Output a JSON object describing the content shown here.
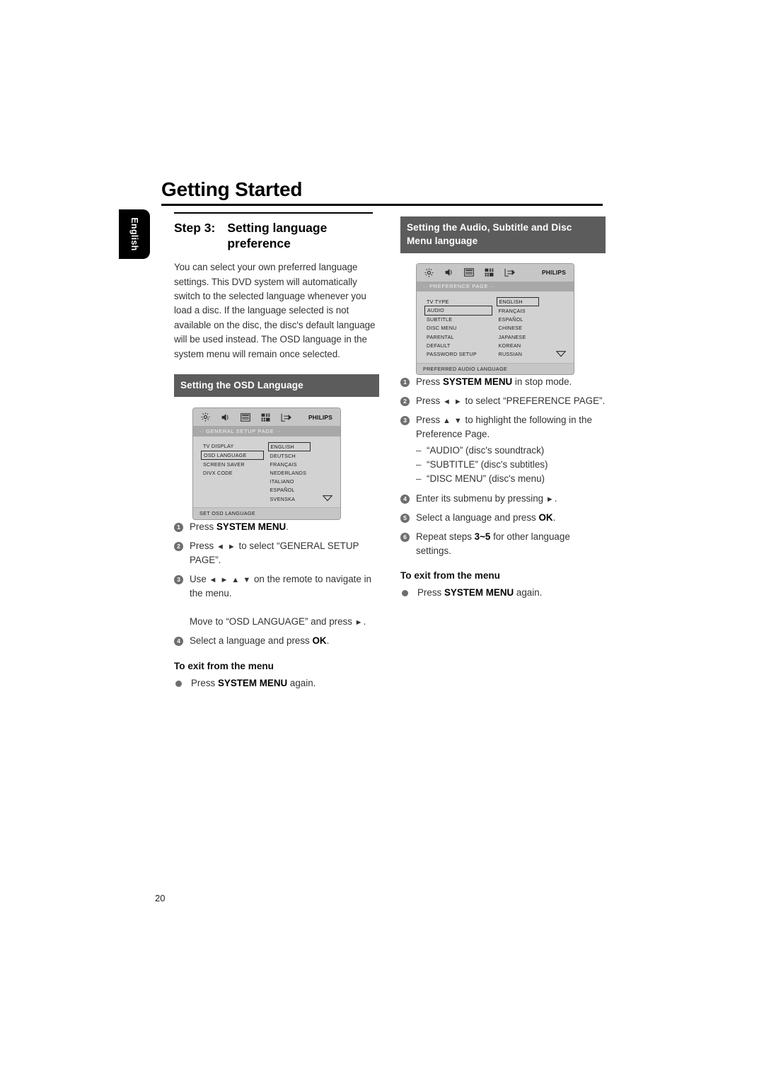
{
  "page": {
    "title": "Getting Started",
    "side_tab": "English",
    "folio": "20",
    "header_bg": "#5c5c5c",
    "screen_bg": "#d2d2d2"
  },
  "left_column": {
    "step_number": "Step 3:",
    "step_title": "Setting language preference",
    "body": "You can select your own preferred language settings. This DVD system will automatically switch to the selected language whenever you load a disc. If the language selected is not available on the disc, the disc's default language will be used instead. The OSD language in the system menu will remain once selected.",
    "section_header": "Setting the OSD Language",
    "screen": {
      "brand": "PHILIPS",
      "page_label": "·· GENERAL  SETUP  PAGE ··",
      "status": "SET OSD LANGUAGE",
      "icons": [
        "gear-icon",
        "speaker-icon",
        "tv-display-icon",
        "grid-icon",
        "exit-arrow-icon"
      ],
      "menu_items": [
        "TV DISPLAY",
        "OSD LANGUAGE",
        "SCREEN SAVER",
        "DIVX CODE"
      ],
      "menu_selected": "OSD LANGUAGE",
      "options": [
        "ENGLISH",
        "DEUTSCH",
        "FRANÇAIS",
        "NEDERLANDS",
        "ITALIANO",
        "ESPAÑOL",
        "SVENSKA"
      ],
      "option_selected": "ENGLISH",
      "scroll_arrow": "▽"
    },
    "steps": [
      {
        "num": "1",
        "html": "Press <b>SYSTEM MENU</b>."
      },
      {
        "num": "2",
        "html": "Press <span class=\"arrow\">◄ ►</span> to select “GENERAL SETUP PAGE”."
      },
      {
        "num": "3",
        "html": "Use <span class=\"arrow\">◄ ► ▲ ▼</span> on the remote to navigate in the menu.<br><br>Move to “OSD LANGUAGE” and press <span class=\"arrow\">►</span>."
      },
      {
        "num": "4",
        "html": "Select a language and press <b>OK</b>."
      }
    ],
    "exit_header": "To exit from the menu",
    "exit_step": "Press <b>SYSTEM MENU</b> again."
  },
  "right_column": {
    "section_header": "Setting the Audio, Subtitle and Disc Menu language",
    "screen": {
      "brand": "PHILIPS",
      "page_label": "·· PREFERENCE  PAGE ··",
      "status": "PREFERRED AUDIO LANGUAGE",
      "icons": [
        "gear-icon",
        "speaker-icon",
        "tv-display-icon",
        "grid-icon",
        "exit-arrow-icon"
      ],
      "menu_items": [
        "TV TYPE",
        "AUDIO",
        "SUBTITLE",
        "DISC MENU",
        "PARENTAL",
        "DEFAULT",
        "PASSWORD SETUP"
      ],
      "menu_selected": "AUDIO",
      "options": [
        "ENGLISH",
        "FRANÇAIS",
        "ESPAÑOL",
        "CHINESE",
        "JAPANESE",
        "KOREAN",
        "RUSSIAN"
      ],
      "option_selected": "ENGLISH",
      "scroll_arrow": "▽"
    },
    "steps": [
      {
        "num": "1",
        "html": "Press <b>SYSTEM MENU</b> in stop mode."
      },
      {
        "num": "2",
        "html": "Press <span class=\"arrow\">◄ ►</span> to select “PREFERENCE PAGE”."
      },
      {
        "num": "3",
        "html": "Press <span class=\"arrow\">▲ ▼</span> to highlight the following in the Preference Page."
      },
      {
        "num": "4",
        "html": "Enter its submenu by pressing <span class=\"arrow\">►</span>."
      },
      {
        "num": "5",
        "html": "Select a language and press <b>OK</b>."
      },
      {
        "num": "6",
        "html": "Repeat steps <b>3~5</b> for other language settings."
      }
    ],
    "sub_items": [
      "“AUDIO” (disc's soundtrack)",
      "“SUBTITLE” (disc's subtitles)",
      "“DISC MENU” (disc's menu)"
    ],
    "sub_dash": "–",
    "exit_header": "To exit from the menu",
    "exit_step": "Press <b>SYSTEM MENU</b> again."
  }
}
